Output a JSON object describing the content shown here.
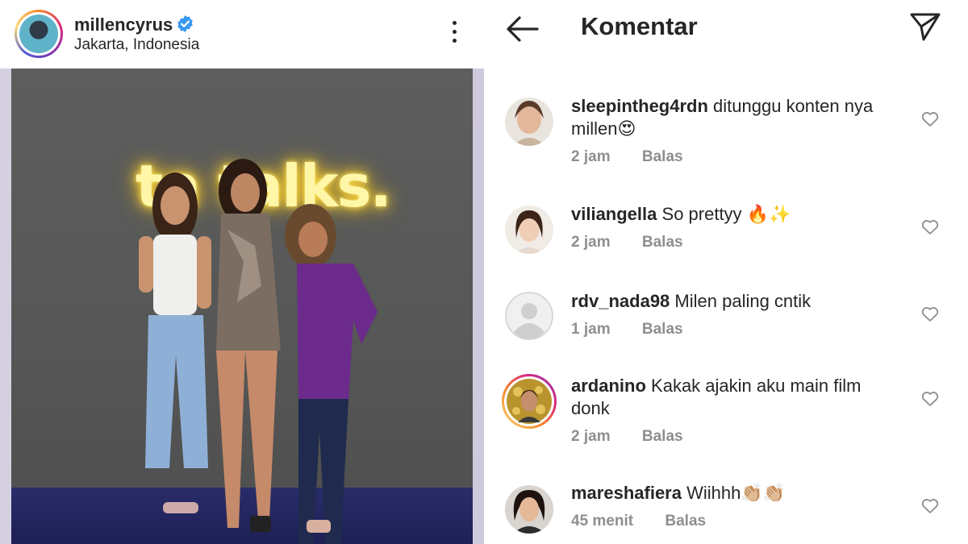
{
  "post": {
    "username": "millencyrus",
    "location": "Jakarta, Indonesia",
    "neon_sign": "ta talks."
  },
  "comments_panel": {
    "title": "Komentar",
    "comments": [
      {
        "user": "sleepintheg4rdn",
        "text": "ditunggu konten nya millen😍",
        "time": "2 jam",
        "reply": "Balas"
      },
      {
        "user": "viliangella",
        "text": "So prettyy 🔥✨",
        "time": "2 jam",
        "reply": "Balas"
      },
      {
        "user": "rdv_nada98",
        "text": "Milen paling cntik",
        "time": "1 jam",
        "reply": "Balas"
      },
      {
        "user": "ardanino",
        "text": "Kakak ajakin aku main film donk",
        "time": "2 jam",
        "reply": "Balas"
      },
      {
        "user": "mareshafiera",
        "text": "Wiihhh👏🏼👏🏼",
        "time": "45 menit",
        "reply": "Balas"
      }
    ]
  },
  "colors": {
    "verified": "#3897f0",
    "meta_gray": "#8e8e8e",
    "text": "#262626"
  }
}
